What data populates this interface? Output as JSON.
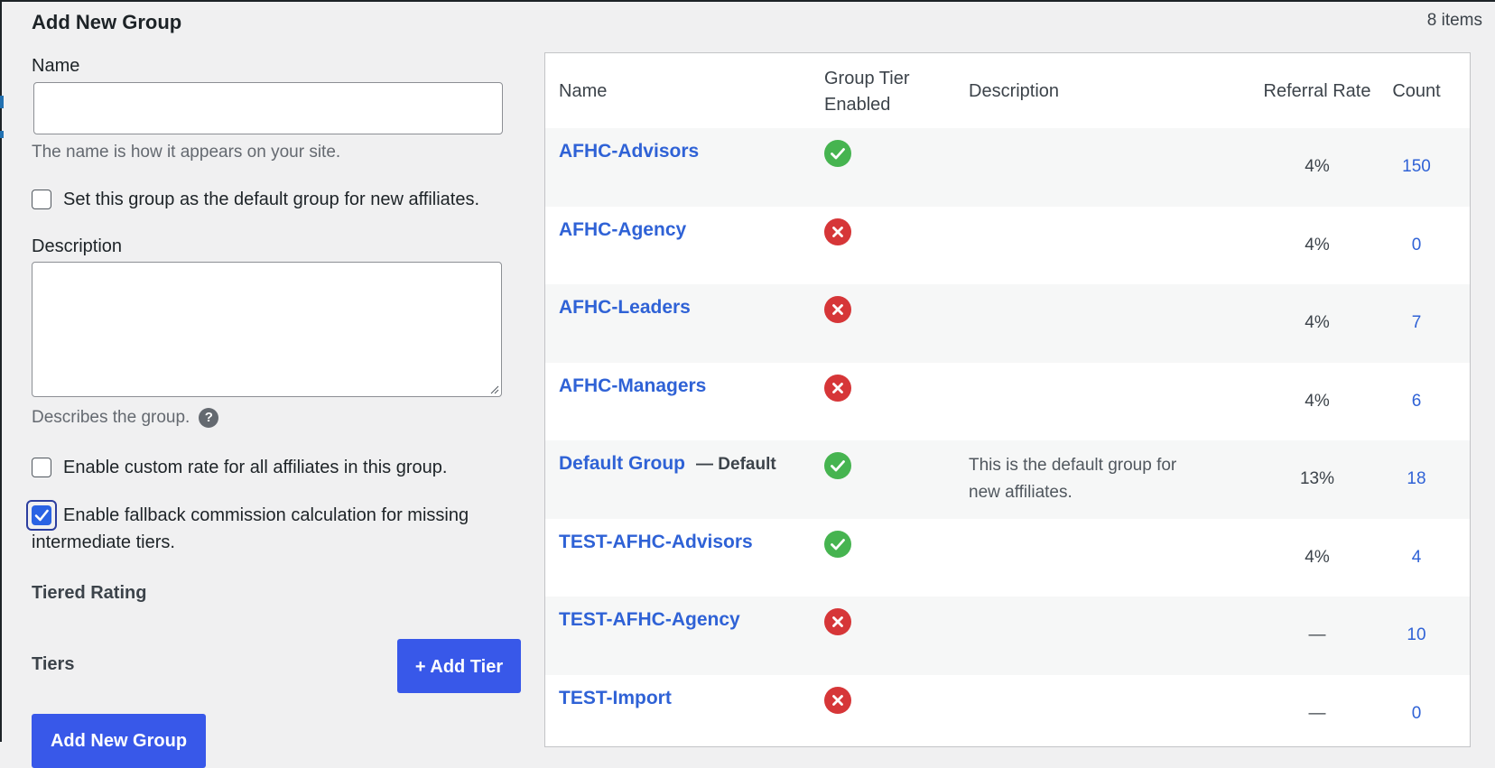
{
  "form": {
    "title": "Add New Group",
    "name_label": "Name",
    "name_value": "",
    "name_help": "The name is how it appears on your site.",
    "default_checkbox_label": "Set this group as the default group for new affiliates.",
    "default_checked": false,
    "description_label": "Description",
    "description_value": "",
    "description_help": "Describes the group.",
    "help_glyph": "?",
    "custom_rate_label": "Enable custom rate for all affiliates in this group.",
    "custom_rate_checked": false,
    "fallback_label": "Enable fallback commission calculation for missing intermediate tiers.",
    "fallback_checked": true,
    "tiered_heading": "Tiered Rating",
    "tiers_label": "Tiers",
    "add_tier_button": "+ Add Tier",
    "submit_button": "Add New Group"
  },
  "table": {
    "items_count": "8 items",
    "headers": {
      "name": "Name",
      "tier_enabled": "Group Tier Enabled",
      "description": "Description",
      "rate": "Referral Rate",
      "count": "Count"
    },
    "rows": [
      {
        "name": "AFHC-Advisors",
        "default_tag": "",
        "tier_enabled": true,
        "description": "",
        "rate": "4%",
        "count": "150"
      },
      {
        "name": "AFHC-Agency",
        "default_tag": "",
        "tier_enabled": false,
        "description": "",
        "rate": "4%",
        "count": "0"
      },
      {
        "name": "AFHC-Leaders",
        "default_tag": "",
        "tier_enabled": false,
        "description": "",
        "rate": "4%",
        "count": "7"
      },
      {
        "name": "AFHC-Managers",
        "default_tag": "",
        "tier_enabled": false,
        "description": "",
        "rate": "4%",
        "count": "6"
      },
      {
        "name": "Default Group",
        "default_tag": "— Default",
        "tier_enabled": true,
        "description": "This is the default group for new affiliates.",
        "rate": "13%",
        "count": "18"
      },
      {
        "name": "TEST-AFHC-Advisors",
        "default_tag": "",
        "tier_enabled": true,
        "description": "",
        "rate": "4%",
        "count": "4"
      },
      {
        "name": "TEST-AFHC-Agency",
        "default_tag": "",
        "tier_enabled": false,
        "description": "",
        "rate": "—",
        "count": "10"
      },
      {
        "name": "TEST-Import",
        "default_tag": "",
        "tier_enabled": false,
        "description": "",
        "rate": "—",
        "count": "0"
      }
    ]
  },
  "icons": {
    "enabled": "check-circle-icon",
    "disabled": "x-circle-icon",
    "help": "help-icon"
  },
  "colors": {
    "accent": "#3858e9",
    "link": "#2f62d6",
    "enabled": "#46b450",
    "disabled": "#d63638"
  }
}
